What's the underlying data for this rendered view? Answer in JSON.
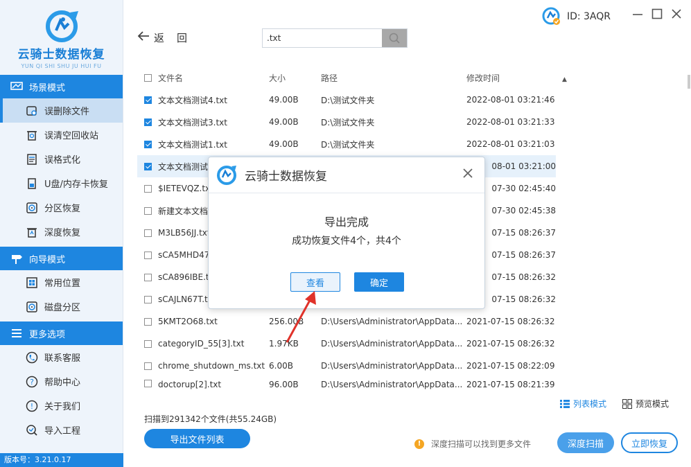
{
  "app": {
    "title": "云骑士数据恢复",
    "subtitle": "YUN QI SHI SHU JU HUI FU",
    "version": "版本号：3.21.0.17",
    "user_id": "ID: 3AQR"
  },
  "sidebar": {
    "sections": [
      {
        "title": "场景模式",
        "items": [
          "误删除文件",
          "误清空回收站",
          "误格式化",
          "U盘/内存卡恢复",
          "分区恢复",
          "深度恢复"
        ]
      },
      {
        "title": "向导模式",
        "items": [
          "常用位置",
          "磁盘分区"
        ]
      },
      {
        "title": "更多选项",
        "items": [
          "联系客服",
          "帮助中心",
          "关于我们",
          "导入工程"
        ]
      }
    ]
  },
  "nav": {
    "back_label": "返回",
    "search_value": ".txt"
  },
  "table": {
    "headers": [
      "文件名",
      "大小",
      "路径",
      "修改时间"
    ],
    "rows": [
      {
        "checked": true,
        "name": "文本文档测试4.txt",
        "size": "49.00B",
        "path": "D:\\测试文件夹",
        "time": "2022-08-01 03:21:46"
      },
      {
        "checked": true,
        "name": "文本文档测试3.txt",
        "size": "49.00B",
        "path": "D:\\测试文件夹",
        "time": "2022-08-01 03:21:33"
      },
      {
        "checked": true,
        "name": "文本文档测试1.txt",
        "size": "49.00B",
        "path": "D:\\测试文件夹",
        "time": "2022-08-01 03:21:03"
      },
      {
        "checked": true,
        "name": "文本文档测试",
        "size": "",
        "path": "",
        "time": "08-01 03:21:00"
      },
      {
        "checked": false,
        "name": "$IETEVQZ.txt",
        "size": "",
        "path": "",
        "time": "07-30 02:45:40"
      },
      {
        "checked": false,
        "name": "新建文本文档",
        "size": "",
        "path": "",
        "time": "07-30 02:45:38"
      },
      {
        "checked": false,
        "name": "M3LB56JJ.txt",
        "size": "",
        "path": "",
        "time": "07-15 08:26:37"
      },
      {
        "checked": false,
        "name": "sCA5MHD47",
        "size": "",
        "path": "",
        "time": "07-15 08:26:37"
      },
      {
        "checked": false,
        "name": "sCA896IBE.txt",
        "size": "",
        "path": "",
        "time": "07-15 08:26:32"
      },
      {
        "checked": false,
        "name": "sCAJLN67T.txt",
        "size": "",
        "path": "",
        "time": "07-15 08:26:32"
      },
      {
        "checked": false,
        "name": "5KMT2O68.txt",
        "size": "256.00B",
        "path": "D:\\Users\\Administrator\\AppData...",
        "time": "2021-07-15 08:26:32"
      },
      {
        "checked": false,
        "name": "categoryID_55[3].txt",
        "size": "1.97KB",
        "path": "D:\\Users\\Administrator\\AppData...",
        "time": "2021-07-15 08:26:32"
      },
      {
        "checked": false,
        "name": "chrome_shutdown_ms.txt",
        "size": "6.00B",
        "path": "D:\\Users\\Administrator\\AppData...",
        "time": "2021-07-15 08:22:09"
      },
      {
        "checked": false,
        "name": "doctorup[2].txt",
        "size": "96.00B",
        "path": "D:\\Users\\Administrator\\AppData...",
        "time": "2021-07-15 08:21:39"
      }
    ]
  },
  "views": {
    "list": "列表模式",
    "preview": "预览模式"
  },
  "footer": {
    "scan_info": "扫描到291342个文件(共55.24GB)",
    "export_list": "导出文件列表",
    "tip": "深度扫描可以找到更多文件",
    "deep_scan": "深度扫描",
    "recover_now": "立即恢复"
  },
  "dialog": {
    "title": "云骑士数据恢复",
    "message_title": "导出完成",
    "message_detail": "成功恢复文件4个，共4个",
    "view_button": "查看",
    "ok_button": "确定"
  },
  "colors": {
    "accent": "#1e86e0",
    "sidebar_bg": "#eef4fb",
    "warning": "#f5a623",
    "annotation_arrow": "#e0322a"
  }
}
